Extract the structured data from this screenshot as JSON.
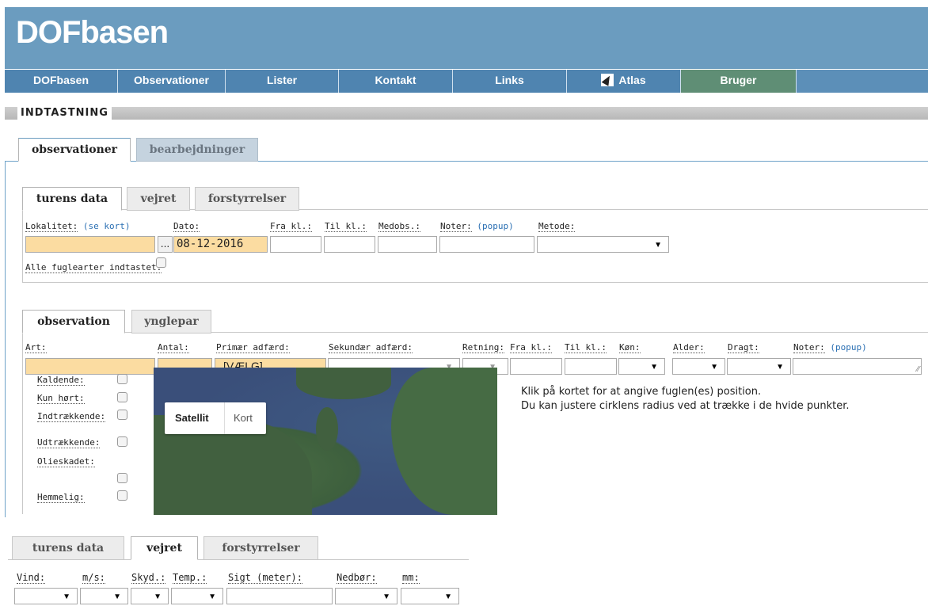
{
  "app_title": "DOFbasen",
  "nav": [
    {
      "label": "DOFbasen"
    },
    {
      "label": "Observationer"
    },
    {
      "label": "Lister"
    },
    {
      "label": "Kontakt"
    },
    {
      "label": "Links"
    },
    {
      "label": "Atlas",
      "icon": "atlas-icon"
    },
    {
      "label": "Bruger"
    }
  ],
  "section_title": "INDTASTNING",
  "main_tabs": {
    "observationer": "observationer",
    "bearbejdninger": "bearbejdninger"
  },
  "trip_tabs": {
    "turens_data": "turens data",
    "vejret": "vejret",
    "forstyrrelser": "forstyrrelser"
  },
  "trip": {
    "lokalitet_label": "Lokalitet:",
    "se_kort_link": "(se kort)",
    "dots": "...",
    "dato_label": "Dato:",
    "dato_value": "08-12-2016",
    "fra_label": "Fra kl.:",
    "til_label": "Til kl.:",
    "medobs_label": "Medobs.:",
    "noter_label": "Noter:",
    "popup_link": "(popup)",
    "metode_label": "Metode:",
    "alle_label": "Alle fuglearter indtastet:"
  },
  "obs_tabs": {
    "observation": "observation",
    "ynglepar": "ynglepar"
  },
  "obs": {
    "art_label": "Art:",
    "antal_label": "Antal:",
    "primaer_label": "Primær adfærd:",
    "primaer_value": "[VÆLG]",
    "sekundaer_label": "Sekundær adfærd:",
    "retning_label": "Retning:",
    "fra_label": "Fra kl.:",
    "til_label": "Til kl.:",
    "koen_label": "Køn:",
    "alder_label": "Alder:",
    "dragt_label": "Dragt:",
    "noter_label": "Noter:",
    "popup_link": "(popup)"
  },
  "flags": [
    "Kaldende:",
    "Kun hørt:",
    "Indtrækkende:",
    "Udtrækkende:",
    "Olieskadet:",
    "Hemmelig:"
  ],
  "map": {
    "satellit": "Satellit",
    "kort": "Kort"
  },
  "help": {
    "line1": "Klik på kortet for at angive fuglen(es) position.",
    "line2": "Du kan justere cirklens radius ved at trække i de hvide punkter."
  },
  "bottom_tabs": {
    "turens_data": "turens data",
    "vejret": "vejret",
    "forstyrrelser": "forstyrrelser"
  },
  "weather": {
    "vind": "Vind:",
    "ms": "m/s:",
    "skyd": "Skyd.:",
    "temp": "Temp.:",
    "sigt": "Sigt (meter):",
    "nedboer": "Nedbør:",
    "mm": "mm:"
  }
}
